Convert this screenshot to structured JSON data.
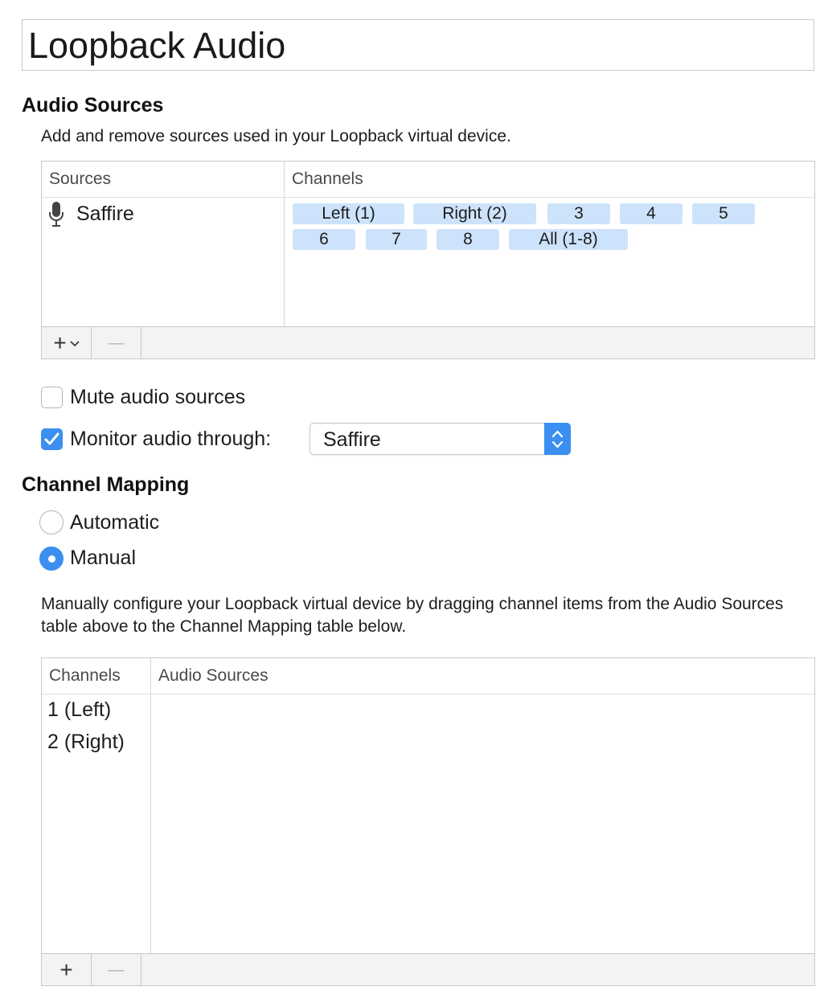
{
  "device_name": "Loopback Audio",
  "audio_sources": {
    "heading": "Audio Sources",
    "description": "Add and remove sources used in your Loopback virtual device.",
    "table": {
      "col_sources": "Sources",
      "col_channels": "Channels",
      "rows": [
        {
          "source": "Saffire",
          "icon": "microphone-icon",
          "channels": [
            "Left (1)",
            "Right (2)",
            "3",
            "4",
            "5",
            "6",
            "7",
            "8",
            "All (1-8)"
          ]
        }
      ]
    },
    "add_button": "+",
    "remove_button": "—"
  },
  "options": {
    "mute_label": "Mute audio sources",
    "mute_checked": false,
    "monitor_label": "Monitor audio through:",
    "monitor_checked": true,
    "monitor_device": "Saffire"
  },
  "channel_mapping": {
    "heading": "Channel Mapping",
    "automatic_label": "Automatic",
    "manual_label": "Manual",
    "selected": "Manual",
    "description": "Manually configure your Loopback virtual device by dragging channel items from the Audio Sources table above to the Channel Mapping table below.",
    "table": {
      "col_channels": "Channels",
      "col_audio_sources": "Audio Sources",
      "rows": [
        "1 (Left)",
        "2 (Right)"
      ]
    },
    "add_button": "+",
    "remove_button": "—"
  },
  "colors": {
    "accent": "#3b8ff0",
    "pill": "#cde3fb"
  }
}
